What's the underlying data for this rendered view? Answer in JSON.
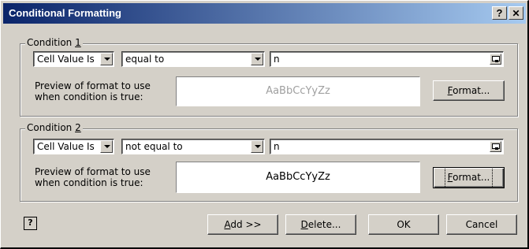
{
  "window": {
    "title": "Conditional Formatting",
    "help_glyph": "?",
    "close_glyph": "✕"
  },
  "conditions": [
    {
      "label_prefix": "Condition ",
      "label_key": "1",
      "type": "Cell Value Is",
      "operator": "equal to",
      "value": "n",
      "preview_label_line1": "Preview of format to use",
      "preview_label_line2": "when condition is true:",
      "preview_text": "AaBbCcYyZz",
      "format_button_key": "F",
      "format_button_rest": "ormat..."
    },
    {
      "label_prefix": "Condition ",
      "label_key": "2",
      "type": "Cell Value Is",
      "operator": "not equal to",
      "value": "n",
      "preview_label_line1": "Preview of format to use",
      "preview_label_line2": "when condition is true:",
      "preview_text": "AaBbCcYyZz",
      "format_button_key": "F",
      "format_button_rest": "ormat..."
    }
  ],
  "footer": {
    "help_icon_glyph": "?",
    "add_key": "A",
    "add_rest": "dd >>",
    "delete_key": "D",
    "delete_rest": "elete...",
    "ok_label": "OK",
    "cancel_label": "Cancel"
  },
  "colors": {
    "titlebar_start": "#0a246a",
    "titlebar_end": "#a6caf0",
    "face": "#d4d0c8",
    "preview_text_1": "#a0a0a0",
    "preview_text_2": "#000000"
  }
}
